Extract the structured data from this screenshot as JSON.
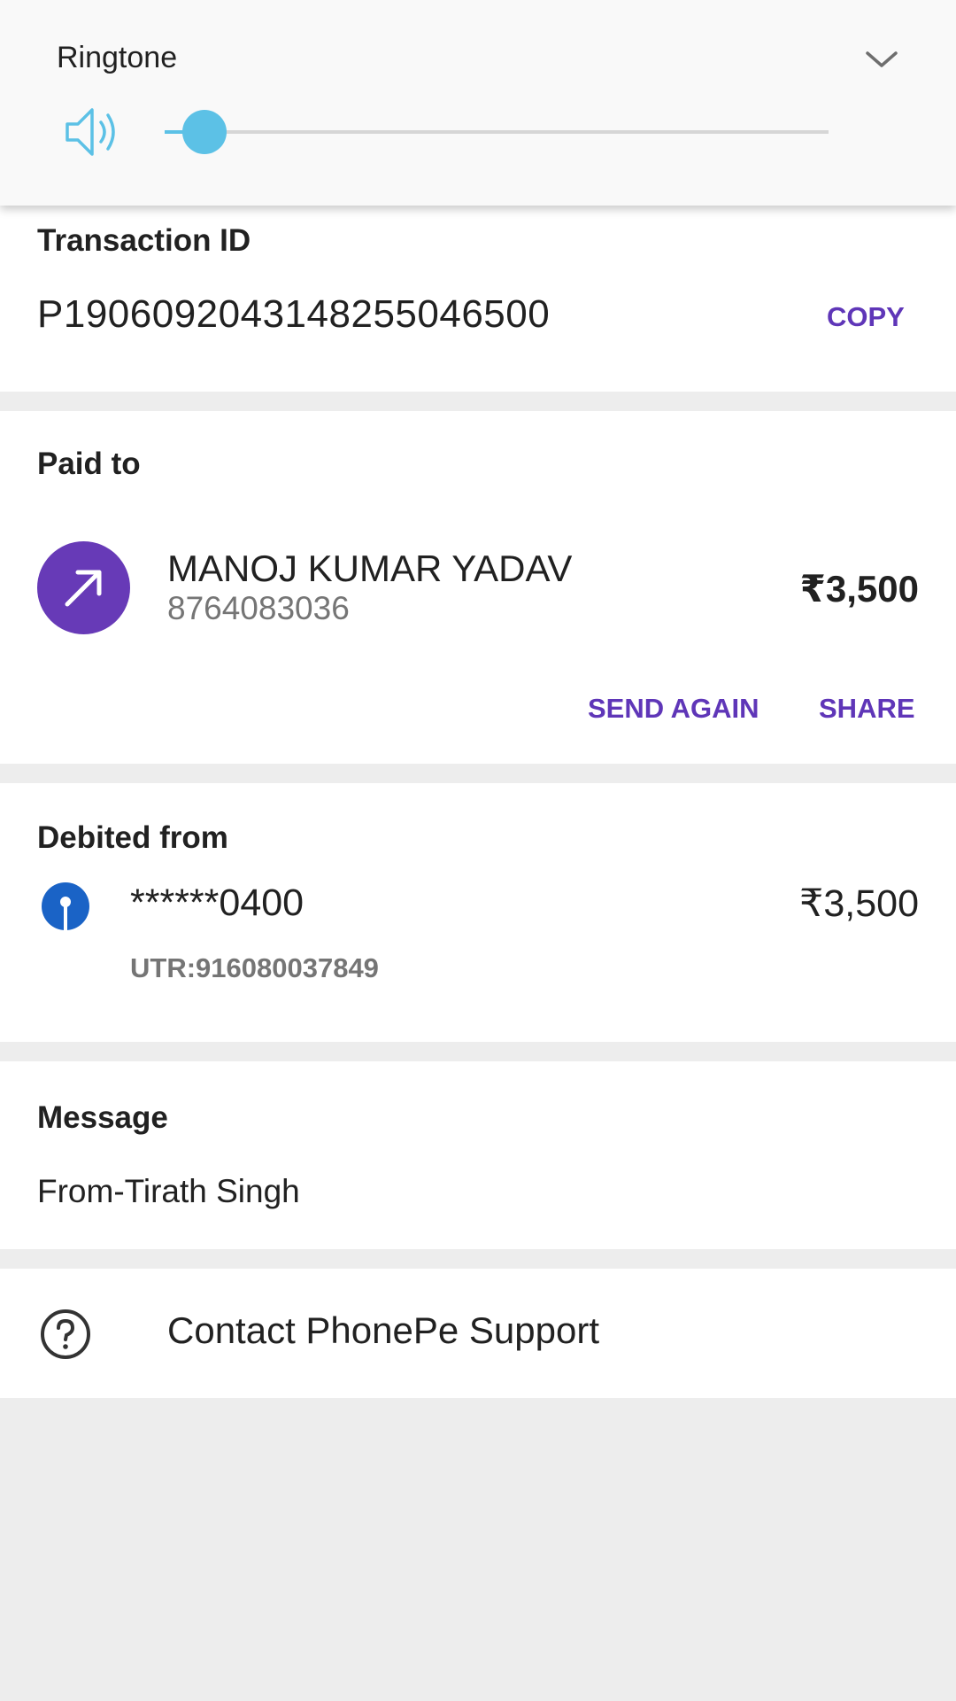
{
  "volume_panel": {
    "label": "Ringtone",
    "level_percent": 6,
    "accent_color": "#5cc1e6"
  },
  "transaction": {
    "section_title": "Transaction ID",
    "id": "P1906092043148255046500",
    "copy_label": "COPY"
  },
  "paid_to": {
    "section_title": "Paid to",
    "name": "MANOJ KUMAR YADAV",
    "phone": "8764083036",
    "amount": "₹3,500",
    "send_again_label": "SEND AGAIN",
    "share_label": "SHARE",
    "avatar_icon": "arrow-up-right-icon",
    "avatar_color": "#673ab7"
  },
  "debited_from": {
    "section_title": "Debited from",
    "account": "******0400",
    "amount": "₹3,500",
    "utr": "UTR:916080037849",
    "bank_icon": "bank-logo-icon",
    "bank_color": "#1a63c6"
  },
  "message": {
    "section_title": "Message",
    "text": "From-Tirath Singh"
  },
  "support": {
    "label": "Contact PhonePe Support",
    "icon": "help-circle-icon"
  },
  "colors": {
    "accent_purple": "#5f36b8",
    "page_background": "#ededed"
  }
}
